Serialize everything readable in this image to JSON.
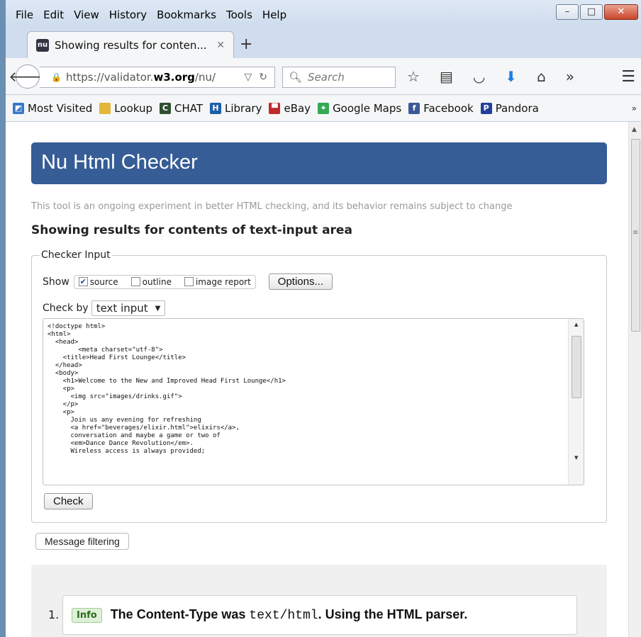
{
  "menu": [
    "File",
    "Edit",
    "View",
    "History",
    "Bookmarks",
    "Tools",
    "Help"
  ],
  "window_controls": {
    "minimize": "–",
    "maximize": "□",
    "close": "✕"
  },
  "tab": {
    "title": "Showing results for conten...",
    "favicon": "nu",
    "close": "✕",
    "new_tab": "+"
  },
  "nav": {
    "url_prefix": "https://validator.",
    "url_host": "w3.org",
    "url_rest": "/nu/",
    "search_placeholder": "Search",
    "icons": [
      "star-icon",
      "reading-list-icon",
      "pocket-icon",
      "download-icon",
      "home-icon",
      "overflow-icon",
      "menu-icon"
    ]
  },
  "bookmarks": [
    {
      "label": "Most Visited",
      "icon": "most-visited-icon",
      "color": "#3a78c8"
    },
    {
      "label": "Lookup",
      "icon": "folder-icon",
      "color": "#e3b63a"
    },
    {
      "label": "CHAT",
      "icon": "chat-icon",
      "color": "#2f4f2f"
    },
    {
      "label": "Library",
      "icon": "library-icon",
      "color": "#1d5fa8"
    },
    {
      "label": "eBay",
      "icon": "ebay-icon",
      "color": "#c02a2a"
    },
    {
      "label": "Google Maps",
      "icon": "maps-icon",
      "color": "#34a853"
    },
    {
      "label": "Facebook",
      "icon": "facebook-icon",
      "color": "#3b5998"
    },
    {
      "label": "Pandora",
      "icon": "pandora-icon",
      "color": "#224099"
    }
  ],
  "page": {
    "header": "Nu Html Checker",
    "tagline": "This tool is an ongoing experiment in better HTML checking, and its behavior remains subject to change",
    "title": "Showing results for contents of text-input area",
    "legend": "Checker Input",
    "show_label": "Show",
    "show_options": [
      {
        "label": "source",
        "checked": true
      },
      {
        "label": "outline",
        "checked": false
      },
      {
        "label": "image report",
        "checked": false
      }
    ],
    "options_button": "Options...",
    "check_by_label": "Check by",
    "check_by_value": "text input",
    "source_code": "<!doctype html>\n<html>\n  <head>\n        <meta charset=\"utf-8\">\n    <title>Head First Lounge</title>\n  </head>\n  <body>\n    <h1>Welcome to the New and Improved Head First Lounge</h1>\n    <p>\n      <img src=\"images/drinks.gif\">\n    </p>\n    <p>\n      Join us any evening for refreshing\n      <a href=\"beverages/elixir.html\">elixirs</a>,\n      conversation and maybe a game or two of\n      <em>Dance Dance Revolution</em>.\n      Wireless access is always provided;",
    "check_button": "Check",
    "filter_button": "Message filtering",
    "result": {
      "number": "1.",
      "badge": "Info",
      "text_before": "The Content-Type was",
      "code": "text/html",
      "text_after": ". Using the HTML parser."
    }
  }
}
